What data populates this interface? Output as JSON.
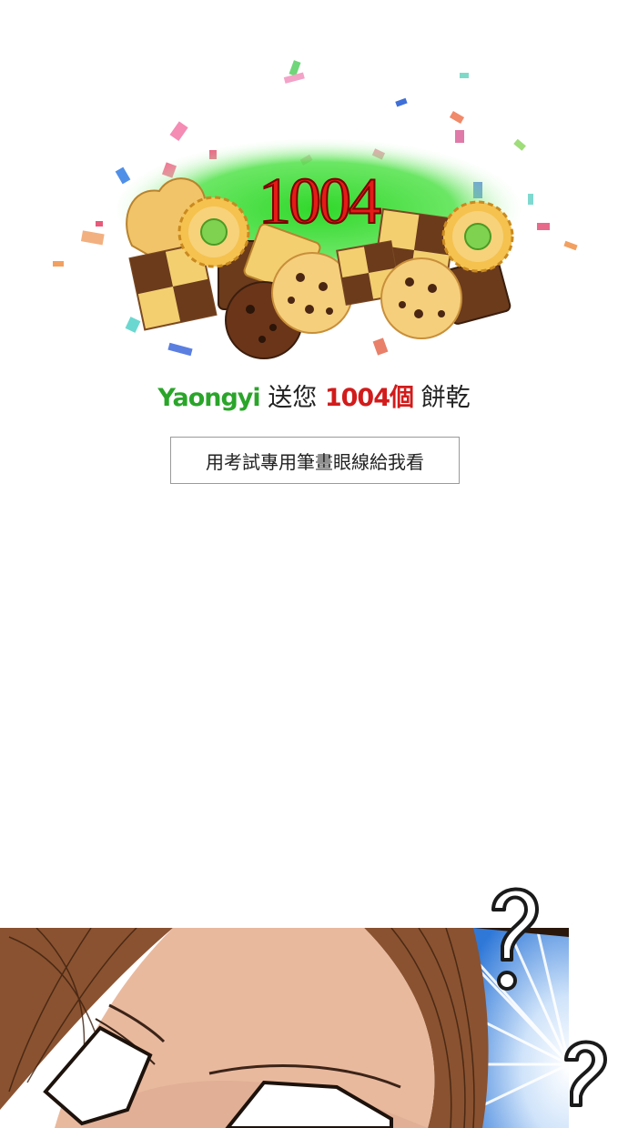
{
  "gift": {
    "number": "1004",
    "sender": "Yaongyi",
    "sent_you": " 送您 ",
    "count_label": "1004個",
    "item_word": " 餅乾"
  },
  "caption": "用考試專用筆畫眼線給我看",
  "icons": {
    "cookie_illustration": "cookie-pile-icon",
    "confetti": "confetti-icon",
    "question_mark": "question-mark-icon"
  },
  "colors": {
    "number_red": "#e41b17",
    "sender_green": "#2aa52a",
    "count_red": "#d21b1b",
    "glow_green": "#3ee03a",
    "hair_brown": "#8a5230",
    "skin": "#e9b99e",
    "burst_blue": "#3f8ee0"
  }
}
